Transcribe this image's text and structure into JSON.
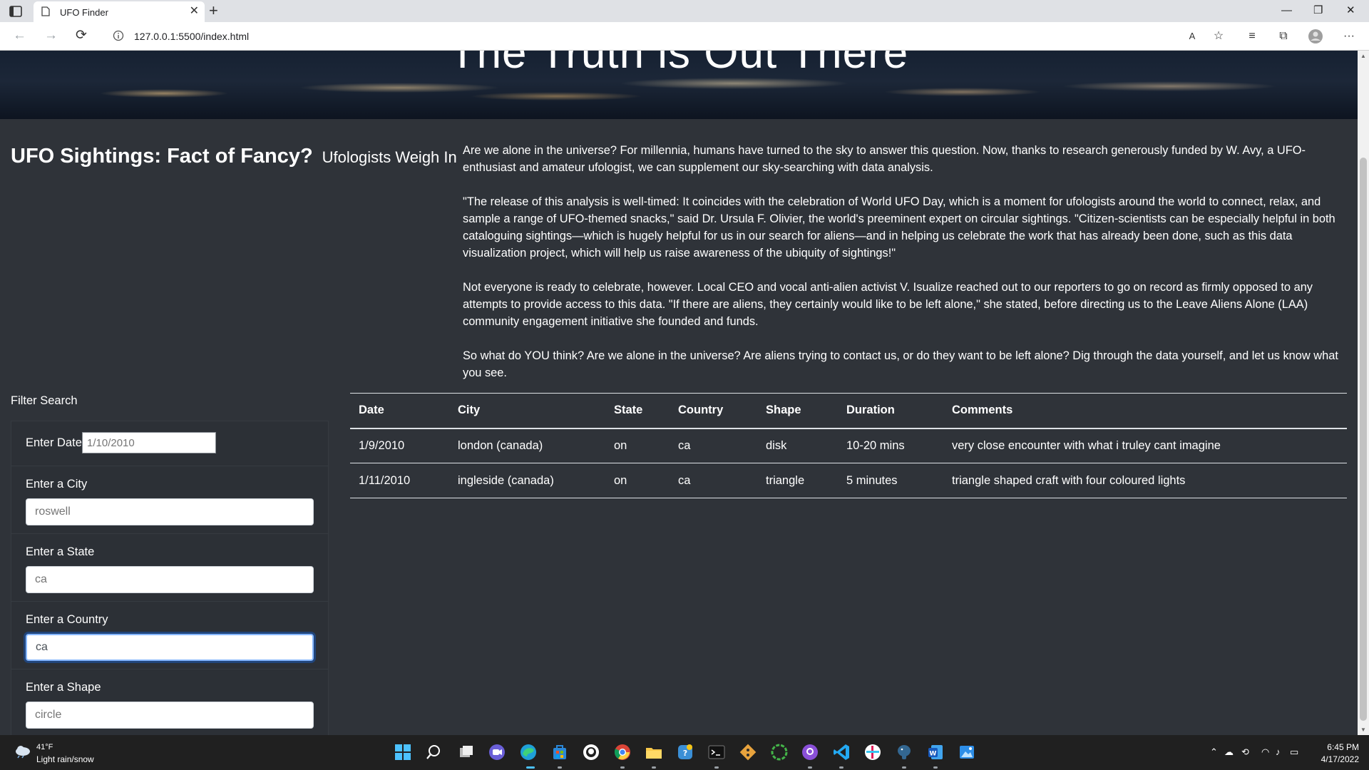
{
  "browser": {
    "tab_title": "UFO Finder",
    "new_tab": "+",
    "tab_close": "✕",
    "url": "127.0.0.1:5500/index.html",
    "window_controls": {
      "minimize": "—",
      "restore": "❐",
      "close": "✕"
    },
    "nav": {
      "back": "←",
      "forward": "→",
      "refresh": "⟳"
    },
    "toolbar_icons": [
      "read-aloud-icon",
      "add-favorite-icon",
      "favorites-icon",
      "collections-icon",
      "profile-icon",
      "more-icon"
    ],
    "toolbar_glyphs": {
      "read_aloud": "A",
      "add_favorite": "☆",
      "favorites": "≡",
      "collections": "⧉",
      "more": "···"
    }
  },
  "page": {
    "hero_title": "The Truth is Out There",
    "heading_main": "UFO Sightings: Fact of Fancy?",
    "heading_sub": "Ufologists Weigh In",
    "article": [
      "Are we alone in the universe? For millennia, humans have turned to the sky to answer this question. Now, thanks to research generously funded by W. Avy, a UFO-enthusiast and amateur ufologist, we can supplement our sky-searching with data analysis.",
      "\"The release of this analysis is well-timed: It coincides with the celebration of World UFO Day, which is a moment for ufologists around the world to connect, relax, and sample a range of UFO-themed snacks,\" said Dr. Ursula F. Olivier, the world's preeminent expert on circular sightings. \"Citizen-scientists can be especially helpful in both cataloguing sightings—which is hugely helpful for us in our search for aliens—and in helping us celebrate the work that has already been done, such as this data visualization project, which will help us raise awareness of the ubiquity of sightings!\"",
      "Not everyone is ready to celebrate, however. Local CEO and vocal anti-alien activist V. Isualize reached out to our reporters to go on record as firmly opposed to any attempts to provide access to this data. \"If there are aliens, they certainly would like to be left alone,\" she stated, before directing us to the Leave Aliens Alone (LAA) community engagement initiative she founded and funds.",
      "So what do YOU think? Are we alone in the universe? Are aliens trying to contact us, or do they want to be left alone? Dig through the data yourself, and let us know what you see."
    ]
  },
  "filters": {
    "title": "Filter Search",
    "date_label": "Enter Date",
    "date_placeholder": "1/10/2010",
    "city_label": "Enter a City",
    "city_placeholder": "roswell",
    "state_label": "Enter a State",
    "state_placeholder": "ca",
    "country_label": "Enter a Country",
    "country_value": "ca",
    "shape_label": "Enter a Shape",
    "shape_placeholder": "circle"
  },
  "table": {
    "headers": [
      "Date",
      "City",
      "State",
      "Country",
      "Shape",
      "Duration",
      "Comments"
    ],
    "rows": [
      [
        "1/9/2010",
        "london (canada)",
        "on",
        "ca",
        "disk",
        "10-20 mins",
        "very close encounter with what i truley cant imagine"
      ],
      [
        "1/11/2010",
        "ingleside (canada)",
        "on",
        "ca",
        "triangle",
        "5 minutes",
        "triangle shaped craft with four coloured lights"
      ]
    ]
  },
  "taskbar": {
    "weather_temp": "41°F",
    "weather_desc": "Light rain/snow",
    "time": "6:45 PM",
    "date": "4/17/2022",
    "apps": [
      "start-icon",
      "search-icon",
      "task-view-icon",
      "chat-icon",
      "edge-icon",
      "store-icon",
      "github-desktop-icon",
      "chrome-icon",
      "file-explorer-icon",
      "python-icon",
      "terminal-icon",
      "git-icon",
      "anaconda-icon",
      "github-icon",
      "vscode-icon",
      "slack-icon",
      "postgres-icon",
      "word-icon",
      "photos-icon"
    ],
    "tray_glyphs": {
      "chevron": "⌃",
      "onedrive": "☁",
      "sync": "⟲",
      "wifi": "◠",
      "volume": "♪",
      "battery": "▭"
    }
  },
  "colors": {
    "page_bg": "#2f3339",
    "focus_ring": "#86b7fe",
    "taskbar_bg": "#202020"
  }
}
